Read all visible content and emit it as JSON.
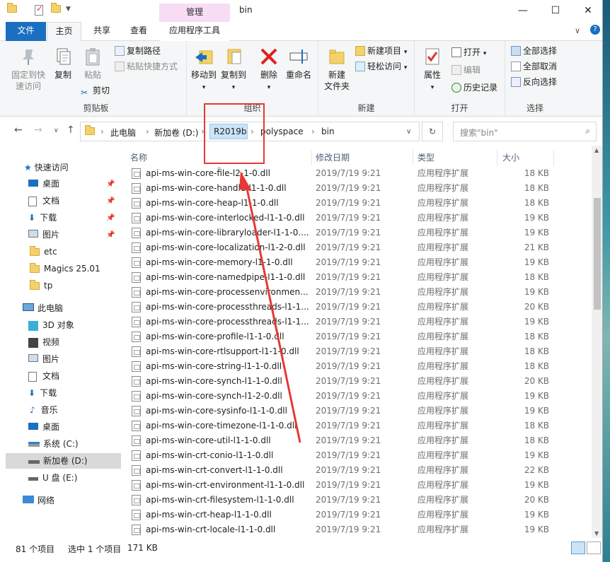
{
  "window": {
    "title": "bin",
    "manage_tab": "管理",
    "min_icon": "minimize-icon",
    "max_icon": "maximize-icon",
    "close_icon": "close-icon",
    "min": "—",
    "max": "☐",
    "close": "✕"
  },
  "menu": {
    "file": "文件",
    "home": "主页",
    "share": "共享",
    "view": "查看",
    "app_tools": "应用程序工具"
  },
  "ribbon": {
    "pin_quick": "固定到快速访问",
    "pin_quick_1": "固定到快",
    "pin_quick_2": "速访问",
    "copy": "复制",
    "paste": "粘贴",
    "copy_path": "复制路径",
    "paste_shortcut": "粘贴快捷方式",
    "cut": "剪切",
    "clipboard": "剪贴板",
    "move_to": "移动到",
    "copy_to": "复制到",
    "delete": "删除",
    "rename": "重命名",
    "organize": "组织",
    "new_folder_1": "新建",
    "new_folder_2": "文件夹",
    "new_item": "新建项目",
    "easy_access": "轻松访问",
    "new": "新建",
    "properties": "属性",
    "open": "打开",
    "edit": "编辑",
    "history": "历史记录",
    "open_group": "打开",
    "select_all": "全部选择",
    "select_none": "全部取消",
    "invert": "反向选择",
    "select": "选择"
  },
  "address": {
    "crumbs": [
      "此电脑",
      "新加卷 (D:)",
      "R2019b",
      "polyspace",
      "bin"
    ],
    "sep": "›",
    "search_placeholder": "搜索\"bin\""
  },
  "sidebar": {
    "quick_access": "快速访问",
    "quick": [
      "桌面",
      "文档",
      "下载",
      "图片",
      "etc",
      "Magics 25.01",
      "tp"
    ],
    "this_pc": "此电脑",
    "pc": [
      "3D 对象",
      "视频",
      "图片",
      "文档",
      "下载",
      "音乐",
      "桌面",
      "系统 (C:)",
      "新加卷 (D:)",
      "U 盘 (E:)"
    ],
    "network": "网络"
  },
  "columns": {
    "name": "名称",
    "date": "修改日期",
    "type": "类型",
    "size": "大小"
  },
  "files": [
    {
      "name": "api-ms-win-core-file-l2-1-0.dll",
      "date": "2019/7/19 9:21",
      "type": "应用程序扩展",
      "size": "18 KB"
    },
    {
      "name": "api-ms-win-core-handle-l1-1-0.dll",
      "date": "2019/7/19 9:21",
      "type": "应用程序扩展",
      "size": "18 KB"
    },
    {
      "name": "api-ms-win-core-heap-l1-1-0.dll",
      "date": "2019/7/19 9:21",
      "type": "应用程序扩展",
      "size": "18 KB"
    },
    {
      "name": "api-ms-win-core-interlocked-l1-1-0.dll",
      "date": "2019/7/19 9:21",
      "type": "应用程序扩展",
      "size": "19 KB"
    },
    {
      "name": "api-ms-win-core-libraryloader-l1-1-0....",
      "date": "2019/7/19 9:21",
      "type": "应用程序扩展",
      "size": "19 KB"
    },
    {
      "name": "api-ms-win-core-localization-l1-2-0.dll",
      "date": "2019/7/19 9:21",
      "type": "应用程序扩展",
      "size": "21 KB"
    },
    {
      "name": "api-ms-win-core-memory-l1-1-0.dll",
      "date": "2019/7/19 9:21",
      "type": "应用程序扩展",
      "size": "19 KB"
    },
    {
      "name": "api-ms-win-core-namedpipe-l1-1-0.dll",
      "date": "2019/7/19 9:21",
      "type": "应用程序扩展",
      "size": "18 KB"
    },
    {
      "name": "api-ms-win-core-processenvironmen...",
      "date": "2019/7/19 9:21",
      "type": "应用程序扩展",
      "size": "19 KB"
    },
    {
      "name": "api-ms-win-core-processthreads-l1-1...",
      "date": "2019/7/19 9:21",
      "type": "应用程序扩展",
      "size": "20 KB"
    },
    {
      "name": "api-ms-win-core-processthreads-l1-1...",
      "date": "2019/7/19 9:21",
      "type": "应用程序扩展",
      "size": "19 KB"
    },
    {
      "name": "api-ms-win-core-profile-l1-1-0.dll",
      "date": "2019/7/19 9:21",
      "type": "应用程序扩展",
      "size": "18 KB"
    },
    {
      "name": "api-ms-win-core-rtlsupport-l1-1-0.dll",
      "date": "2019/7/19 9:21",
      "type": "应用程序扩展",
      "size": "18 KB"
    },
    {
      "name": "api-ms-win-core-string-l1-1-0.dll",
      "date": "2019/7/19 9:21",
      "type": "应用程序扩展",
      "size": "18 KB"
    },
    {
      "name": "api-ms-win-core-synch-l1-1-0.dll",
      "date": "2019/7/19 9:21",
      "type": "应用程序扩展",
      "size": "20 KB"
    },
    {
      "name": "api-ms-win-core-synch-l1-2-0.dll",
      "date": "2019/7/19 9:21",
      "type": "应用程序扩展",
      "size": "19 KB"
    },
    {
      "name": "api-ms-win-core-sysinfo-l1-1-0.dll",
      "date": "2019/7/19 9:21",
      "type": "应用程序扩展",
      "size": "19 KB"
    },
    {
      "name": "api-ms-win-core-timezone-l1-1-0.dll",
      "date": "2019/7/19 9:21",
      "type": "应用程序扩展",
      "size": "18 KB"
    },
    {
      "name": "api-ms-win-core-util-l1-1-0.dll",
      "date": "2019/7/19 9:21",
      "type": "应用程序扩展",
      "size": "18 KB"
    },
    {
      "name": "api-ms-win-crt-conio-l1-1-0.dll",
      "date": "2019/7/19 9:21",
      "type": "应用程序扩展",
      "size": "19 KB"
    },
    {
      "name": "api-ms-win-crt-convert-l1-1-0.dll",
      "date": "2019/7/19 9:21",
      "type": "应用程序扩展",
      "size": "22 KB"
    },
    {
      "name": "api-ms-win-crt-environment-l1-1-0.dll",
      "date": "2019/7/19 9:21",
      "type": "应用程序扩展",
      "size": "19 KB"
    },
    {
      "name": "api-ms-win-crt-filesystem-l1-1-0.dll",
      "date": "2019/7/19 9:21",
      "type": "应用程序扩展",
      "size": "20 KB"
    },
    {
      "name": "api-ms-win-crt-heap-l1-1-0.dll",
      "date": "2019/7/19 9:21",
      "type": "应用程序扩展",
      "size": "19 KB"
    },
    {
      "name": "api-ms-win-crt-locale-l1-1-0.dll",
      "date": "2019/7/19 9:21",
      "type": "应用程序扩展",
      "size": "19 KB"
    }
  ],
  "status": {
    "count": "81 个项目",
    "selected": "选中 1 个项目",
    "size": "171 KB"
  },
  "colors": {
    "accent": "#1a6fc0",
    "annotation": "#e53935",
    "manage_tab": "#f7dcf4"
  }
}
